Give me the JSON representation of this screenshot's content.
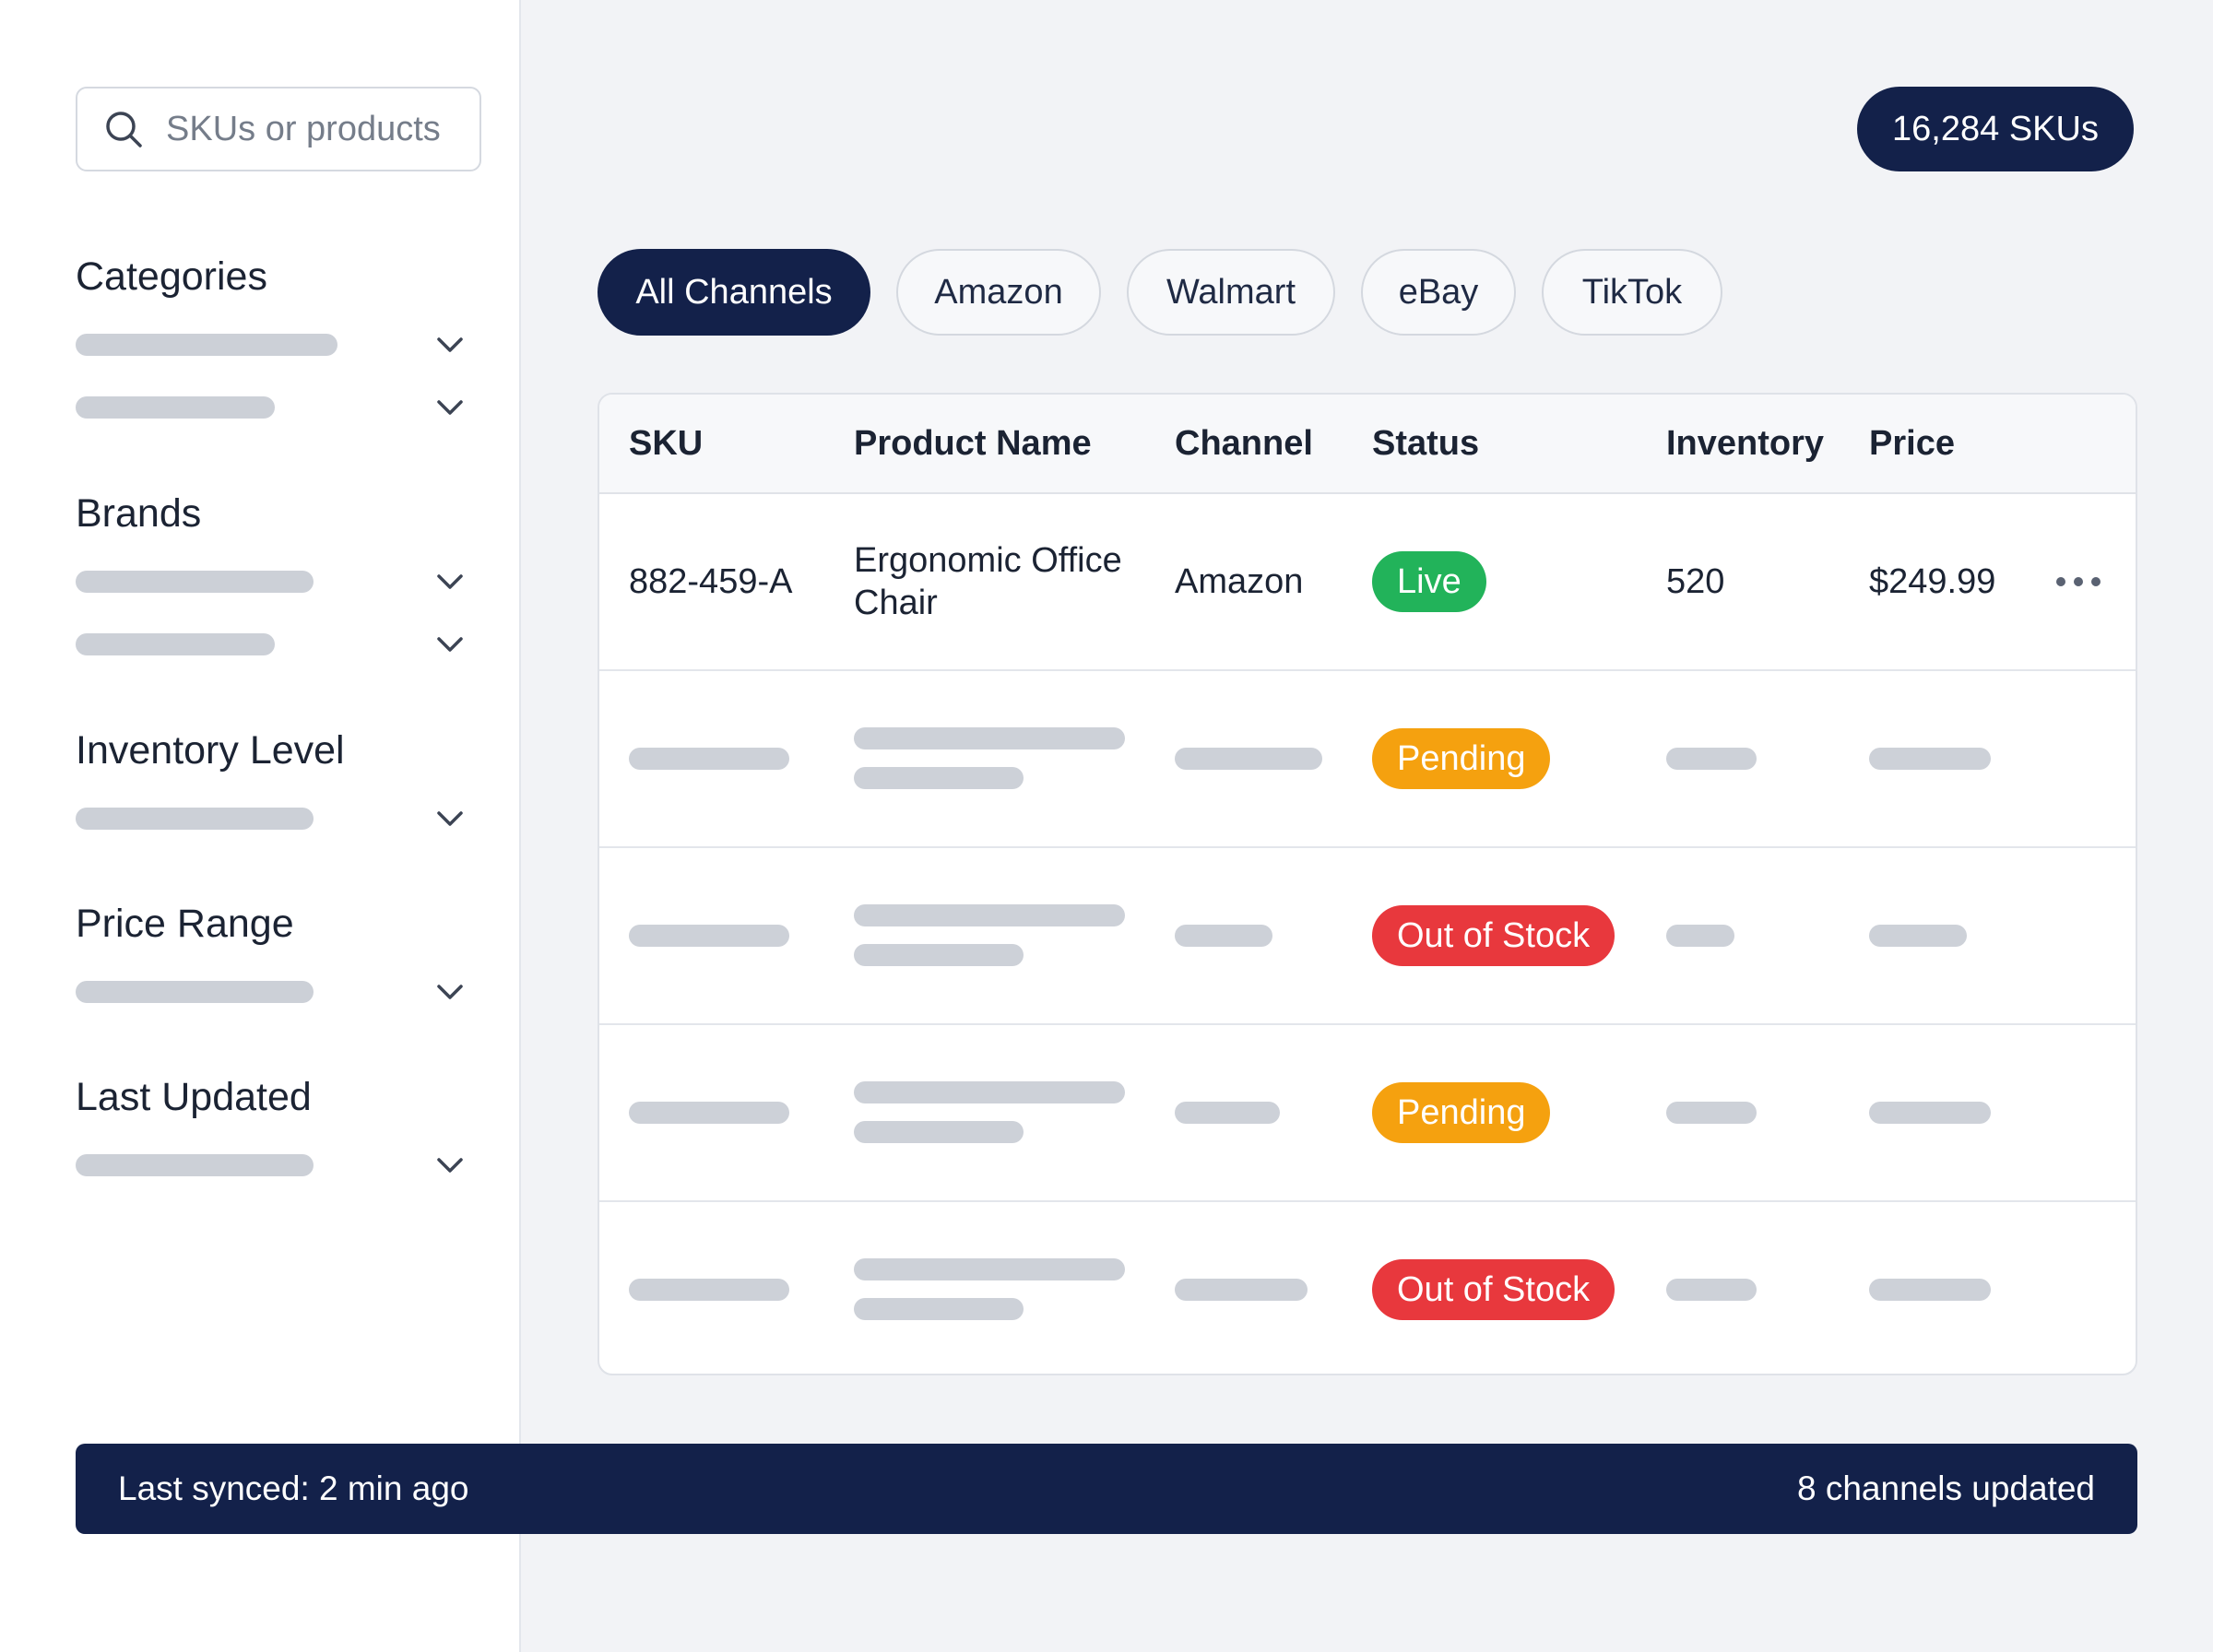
{
  "search": {
    "placeholder": "SKUs or products",
    "icon": "search-icon"
  },
  "filters": [
    {
      "title": "Categories",
      "rows": 2
    },
    {
      "title": "Brands",
      "rows": 2
    },
    {
      "title": "Inventory Level",
      "rows": 1
    },
    {
      "title": "Price Range",
      "rows": 1
    },
    {
      "title": "Last Updated",
      "rows": 1
    }
  ],
  "sku_count": "16,284 SKUs",
  "tabs": [
    {
      "label": "All Channels",
      "active": true
    },
    {
      "label": "Amazon",
      "active": false
    },
    {
      "label": "Walmart",
      "active": false
    },
    {
      "label": "eBay",
      "active": false
    },
    {
      "label": "TikTok",
      "active": false
    }
  ],
  "table": {
    "columns": [
      "SKU",
      "Product Name",
      "Channel",
      "Status",
      "Inventory",
      "Price"
    ],
    "rows": [
      {
        "sku": "882-459-A",
        "product_name": "Ergonomic Office Chair",
        "channel": "Amazon",
        "status": "Live",
        "inventory": "520",
        "price": "$249.99"
      },
      {
        "status": "Pending"
      },
      {
        "status": "Out of Stock"
      },
      {
        "status": "Pending"
      },
      {
        "status": "Out of Stock"
      }
    ],
    "row_menu_icon": "more-horizontal-icon"
  },
  "status_colors": {
    "Live": "#22b35a",
    "Pending": "#f5a10f",
    "Out of Stock": "#e8383d"
  },
  "accent_color": "#13214a",
  "footer": {
    "left": "Last synced: 2 min ago",
    "right": "8 channels updated"
  }
}
